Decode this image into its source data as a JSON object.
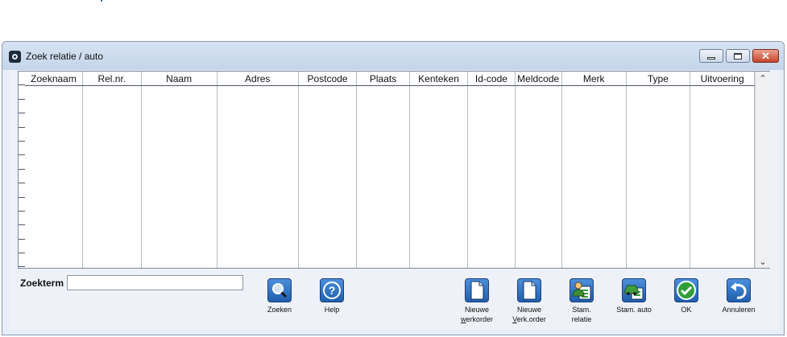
{
  "window": {
    "title": "Zoek relatie / auto",
    "controls": {
      "minimize": "minimize",
      "maximize": "maximize",
      "close": "close"
    }
  },
  "grid": {
    "columns": [
      "Zoeknaam",
      "Rel.nr.",
      "Naam",
      "Adres",
      "Postcode",
      "Plaats",
      "Kenteken",
      "Id-code",
      "Meldcode",
      "Merk",
      "Type",
      "Uitvoering"
    ],
    "rows": []
  },
  "search": {
    "label": "Zoekterm",
    "value": ""
  },
  "toolbar": {
    "zoeken": "Zoeken",
    "help": "Help",
    "nieuwe_werkorder_l1": "Nieuwe",
    "nieuwe_werkorder_l2_u": "w",
    "nieuwe_werkorder_l2_rest": "erkorder",
    "nieuwe_verk_l1": "Nieuwe",
    "nieuwe_verk_l2_u": "V",
    "nieuwe_verk_l2_rest": "erk.order",
    "stam_relatie_l1": "Stam.",
    "stam_relatie_l2": "relatie",
    "stam_auto": "Stam. auto",
    "ok": "OK",
    "annuleren": "Annuleren"
  },
  "icons": {
    "app": "app-icon",
    "zoeken": "magnifier-icon",
    "help": "question-icon",
    "nieuwe_werkorder": "document-icon",
    "nieuwe_verk": "document-icon",
    "stam_relatie": "person-card-icon",
    "stam_auto": "car-card-icon",
    "ok": "checkmark-icon",
    "annuleren": "undo-arrow-icon"
  },
  "colors": {
    "titlebar": "#c9d9ec",
    "button_blue": "#2e6fc2",
    "ok_green": "#2f9e3a",
    "close_red": "#c7452d"
  }
}
